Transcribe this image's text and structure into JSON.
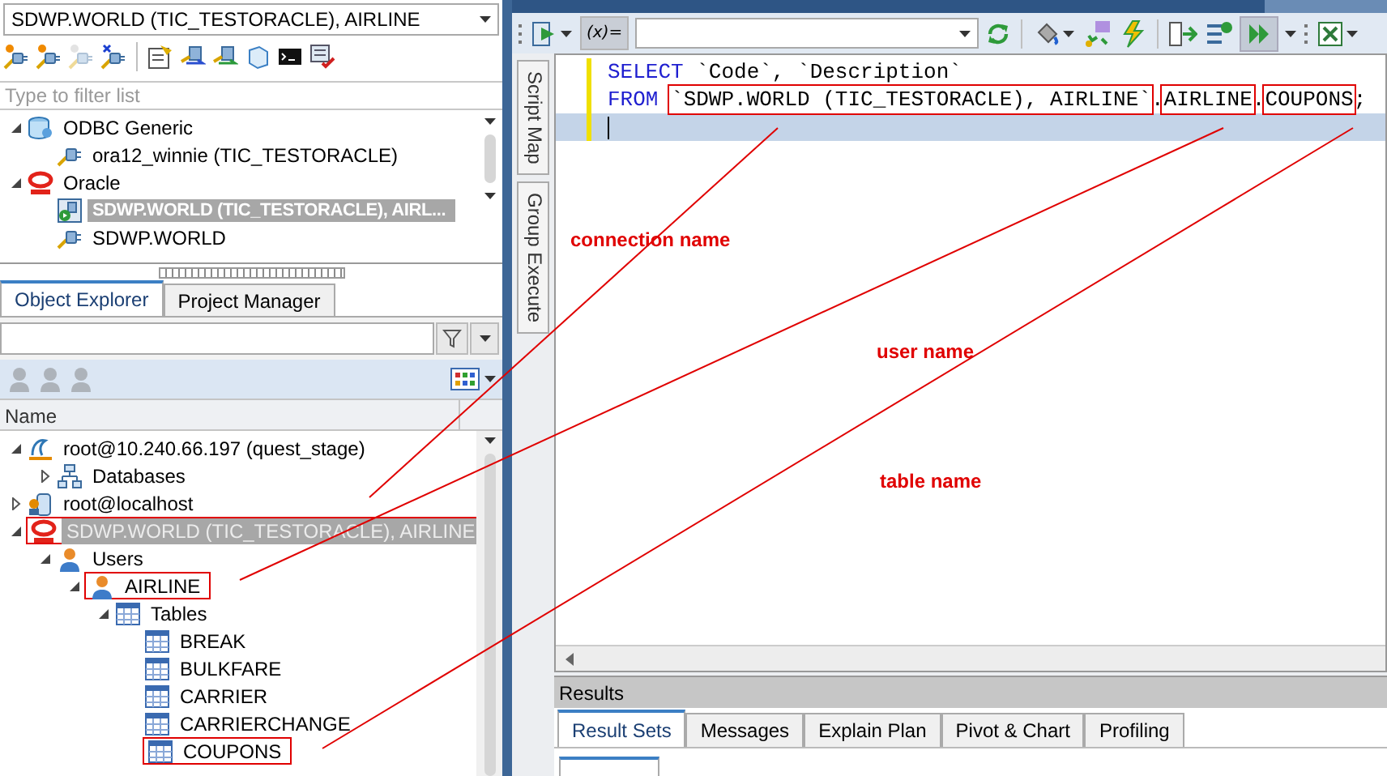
{
  "connection_selector": {
    "value": "SDWP.WORLD (TIC_TESTORACLE), AIRLINE"
  },
  "connection_filter": {
    "placeholder": "Type to filter list"
  },
  "connections": [
    {
      "label": "ODBC Generic",
      "kind": "database",
      "expanded": true,
      "selected": false,
      "children": [
        {
          "label": "ora12_winnie (TIC_TESTORACLE)",
          "kind": "plug",
          "selected": false
        }
      ]
    },
    {
      "label": "Oracle",
      "kind": "oracle",
      "expanded": true,
      "selected": false,
      "children": [
        {
          "label": "SDWP.WORLD (TIC_TESTORACLE), AIRL...",
          "kind": "active",
          "selected": true
        },
        {
          "label": "SDWP.WORLD",
          "kind": "plug",
          "selected": false
        }
      ]
    }
  ],
  "explorer_tabs": [
    {
      "label": "Object Explorer",
      "selected": true
    },
    {
      "label": "Project Manager",
      "selected": false
    }
  ],
  "column_header": "Name",
  "tree": [
    {
      "label": "root@10.240.66.197 (quest_stage)",
      "kind": "swirl",
      "expanded": true,
      "selected": false,
      "boxed": false,
      "children": [
        {
          "label": "Databases",
          "kind": "hierarchy",
          "expanded": false,
          "selected": false,
          "boxed": false
        }
      ]
    },
    {
      "label": "root@localhost",
      "kind": "server",
      "expanded": false,
      "selected": false,
      "boxed": false
    },
    {
      "label": "SDWP.WORLD (TIC_TESTORACLE), AIRLINE",
      "kind": "oracle",
      "expanded": true,
      "selected": true,
      "boxed": true,
      "children": [
        {
          "label": "Users",
          "kind": "user",
          "expanded": true,
          "selected": false,
          "boxed": false,
          "children": [
            {
              "label": "AIRLINE",
              "kind": "user",
              "expanded": true,
              "selected": false,
              "boxed": true,
              "children": [
                {
                  "label": "Tables",
                  "kind": "table",
                  "expanded": true,
                  "selected": false,
                  "boxed": false,
                  "children": [
                    {
                      "label": "BREAK",
                      "kind": "table",
                      "selected": false,
                      "boxed": false
                    },
                    {
                      "label": "BULKFARE",
                      "kind": "table",
                      "selected": false,
                      "boxed": false
                    },
                    {
                      "label": "CARRIER",
                      "kind": "table",
                      "selected": false,
                      "boxed": false
                    },
                    {
                      "label": "CARRIERCHANGE",
                      "kind": "table",
                      "selected": false,
                      "boxed": false
                    },
                    {
                      "label": "COUPONS",
                      "kind": "table",
                      "selected": false,
                      "boxed": true
                    }
                  ]
                }
              ]
            }
          ]
        }
      ]
    }
  ],
  "toolbar": {
    "variables_button": "(x)="
  },
  "side_tabs": [
    {
      "label": "Script Map"
    },
    {
      "label": "Group Execute"
    }
  ],
  "editor": {
    "lines": [
      {
        "current": false,
        "tokens": [
          {
            "kind": "keyword",
            "text": "SELECT",
            "boxed": false
          },
          {
            "kind": "plain",
            "text": " `Code`, `Description`",
            "boxed": false
          }
        ]
      },
      {
        "current": false,
        "tokens": [
          {
            "kind": "keyword",
            "text": "FROM ",
            "boxed": false
          },
          {
            "kind": "plain",
            "text": "`SDWP.WORLD (TIC_TESTORACLE), AIRLINE`",
            "boxed": true
          },
          {
            "kind": "plain",
            "text": ".",
            "boxed": false
          },
          {
            "kind": "plain",
            "text": "AIRLINE",
            "boxed": true
          },
          {
            "kind": "plain",
            "text": ".",
            "boxed": false
          },
          {
            "kind": "plain",
            "text": "COUPONS",
            "boxed": true
          },
          {
            "kind": "plain",
            "text": ";",
            "boxed": false
          }
        ]
      },
      {
        "current": true
      }
    ]
  },
  "annotations": [
    {
      "label": "connection name"
    },
    {
      "label": "user name"
    },
    {
      "label": "table name"
    }
  ],
  "results": {
    "title": "Results",
    "tabs": [
      {
        "label": "Result Sets",
        "selected": true
      },
      {
        "label": "Messages",
        "selected": false
      },
      {
        "label": "Explain Plan",
        "selected": false
      },
      {
        "label": "Pivot & Chart",
        "selected": false
      },
      {
        "label": "Profiling",
        "selected": false
      }
    ]
  }
}
